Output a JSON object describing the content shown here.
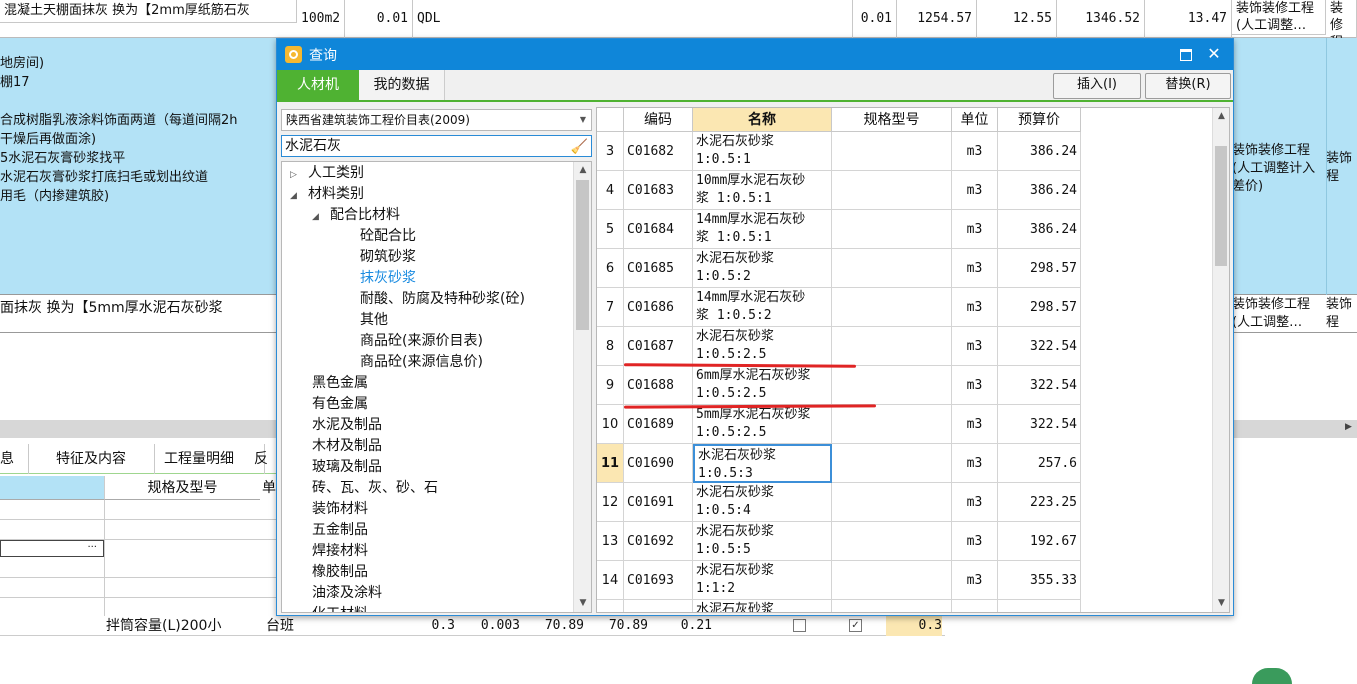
{
  "top_row": {
    "desc": "混凝土天棚面抹灰   换为【2mm厚纸筋石灰",
    "unit": "100m2",
    "qty": "0.01",
    "code": "QDL",
    "qty2": "0.01",
    "price": "1254.57",
    "v1": "12.55",
    "v2": "1346.52",
    "v3": "13.47",
    "cat": "装饰装修工程(人工调整…",
    "cat2": "装修程"
  },
  "blue_area": {
    "lines": [
      "地房间)",
      "棚17",
      "",
      "合成树脂乳液涂料饰面两道（每道间隔2h",
      "干燥后再做面涂)",
      "5水泥石灰膏砂浆找平",
      "水泥石灰膏砂浆打底扫毛或划出纹道",
      "用毛（内掺建筑胶)"
    ],
    "cat": "装饰装修工程(人工调整计入差价)",
    "cat2": "装饰程"
  },
  "row2": {
    "desc": "面抹灰    换为【5mm厚水泥石灰砂浆",
    "cat": "装饰装修工程(人工调整…",
    "cat2": "装饰程"
  },
  "bottom_tabs": [
    "息",
    "特征及内容",
    "工程量明细",
    "反"
  ],
  "bottom_header": {
    "spec": "规格及型号",
    "unit": "单"
  },
  "bottom_row": {
    "name": "拌筒容量(L)200小",
    "unit": "台班",
    "a": "0.3",
    "b": "0.003",
    "c": "70.89",
    "d": "70.89",
    "e": "0.21",
    "f": "0.3",
    "ellipsis": "···"
  },
  "dialog": {
    "title": "查询",
    "tabs": [
      "人材机",
      "我的数据"
    ],
    "insert_btn": "插入(I)",
    "replace_btn": "替换(R)",
    "catalog": "陕西省建筑装饰工程价目表(2009)",
    "search": "水泥石灰",
    "tree": [
      {
        "label": "人工类别",
        "level": 0,
        "toggle": "▷"
      },
      {
        "label": "材料类别",
        "level": 0,
        "toggle": "◢"
      },
      {
        "label": "配合比材料",
        "level": 1,
        "toggle": "◢"
      },
      {
        "label": "砼配合比",
        "level": 2
      },
      {
        "label": "砌筑砂浆",
        "level": 2
      },
      {
        "label": "抹灰砂浆",
        "level": 2,
        "selected": true
      },
      {
        "label": "耐酸、防腐及特种砂浆(砼)",
        "level": 2
      },
      {
        "label": "其他",
        "level": 2
      },
      {
        "label": "商品砼(来源价目表)",
        "level": 2
      },
      {
        "label": "商品砼(来源信息价)",
        "level": 2
      },
      {
        "label": "黑色金属",
        "level": 1
      },
      {
        "label": "有色金属",
        "level": 1
      },
      {
        "label": "水泥及制品",
        "level": 1
      },
      {
        "label": "木材及制品",
        "level": 1
      },
      {
        "label": "玻璃及制品",
        "level": 1
      },
      {
        "label": "砖、瓦、灰、砂、石",
        "level": 1
      },
      {
        "label": "装饰材料",
        "level": 1
      },
      {
        "label": "五金制品",
        "level": 1
      },
      {
        "label": "焊接材料",
        "level": 1
      },
      {
        "label": "橡胶制品",
        "level": 1
      },
      {
        "label": "油漆及涂料",
        "level": 1
      },
      {
        "label": "化工材料",
        "level": 1
      }
    ],
    "columns": [
      "编码",
      "名称",
      "规格型号",
      "单位",
      "预算价"
    ],
    "rows": [
      {
        "n": "3",
        "code": "C01682",
        "name": "水泥石灰砂浆\n1:0.5:1",
        "unit": "m3",
        "price": "386.24"
      },
      {
        "n": "4",
        "code": "C01683",
        "name": "10mm厚水泥石灰砂\n浆 1:0.5:1",
        "unit": "m3",
        "price": "386.24"
      },
      {
        "n": "5",
        "code": "C01684",
        "name": "14mm厚水泥石灰砂\n浆 1:0.5:1",
        "unit": "m3",
        "price": "386.24"
      },
      {
        "n": "6",
        "code": "C01685",
        "name": "水泥石灰砂浆\n1:0.5:2",
        "unit": "m3",
        "price": "298.57"
      },
      {
        "n": "7",
        "code": "C01686",
        "name": "14mm厚水泥石灰砂\n浆 1:0.5:2",
        "unit": "m3",
        "price": "298.57"
      },
      {
        "n": "8",
        "code": "C01687",
        "name": "水泥石灰砂浆\n1:0.5:2.5",
        "unit": "m3",
        "price": "322.54"
      },
      {
        "n": "9",
        "code": "C01688",
        "name": "6mm厚水泥石灰砂浆\n1:0.5:2.5",
        "unit": "m3",
        "price": "322.54"
      },
      {
        "n": "10",
        "code": "C01689",
        "name": "5mm厚水泥石灰砂浆\n1:0.5:2.5",
        "unit": "m3",
        "price": "322.54"
      },
      {
        "n": "11",
        "code": "C01690",
        "name": "水泥石灰砂浆\n1:0.5:3",
        "unit": "m3",
        "price": "257.6",
        "selected": true
      },
      {
        "n": "12",
        "code": "C01691",
        "name": "水泥石灰砂浆\n1:0.5:4",
        "unit": "m3",
        "price": "223.25"
      },
      {
        "n": "13",
        "code": "C01692",
        "name": "水泥石灰砂浆\n1:0.5:5",
        "unit": "m3",
        "price": "192.67"
      },
      {
        "n": "14",
        "code": "C01693",
        "name": "水泥石灰砂浆\n1:1:2",
        "unit": "m3",
        "price": "355.33"
      },
      {
        "n": "",
        "code": "",
        "name": "水泥石灰砂浆",
        "unit": "",
        "price": ""
      }
    ]
  },
  "colors": {
    "title_blue": "#0f86d9",
    "tab_green": "#4fb232",
    "row_blue": "#b3e2f6",
    "highlight": "#fbe7b2",
    "annotation_red": "#e02424"
  }
}
